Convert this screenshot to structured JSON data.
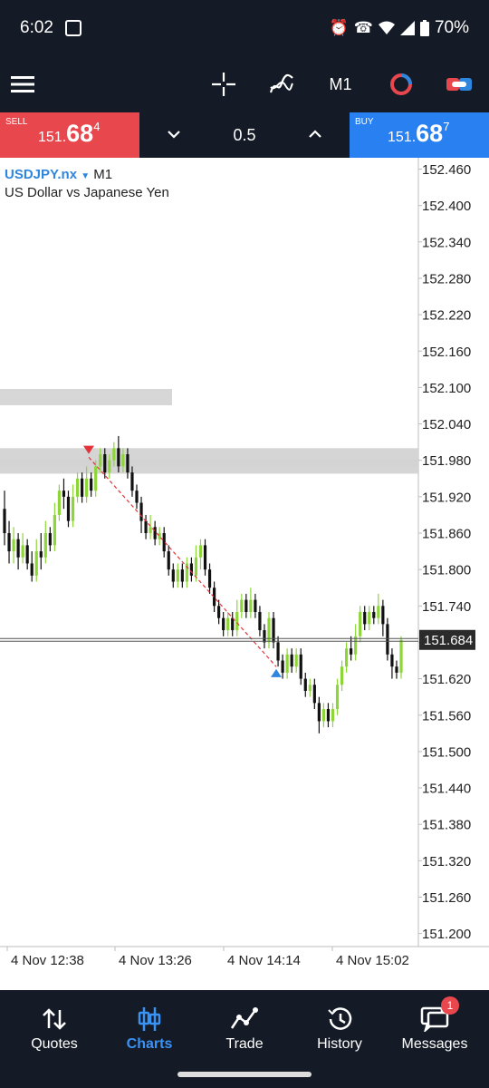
{
  "status_bar": {
    "time": "6:02",
    "battery": "70%"
  },
  "toolbar": {
    "timeframe": "M1"
  },
  "trade": {
    "sell": {
      "label": "SELL",
      "price_prefix": "151.",
      "price_big": "68",
      "price_sup": "4"
    },
    "buy": {
      "label": "BUY",
      "price_prefix": "151.",
      "price_big": "68",
      "price_sup": "7"
    },
    "volume": "0.5"
  },
  "chart_header": {
    "symbol": "USDJPY.nx",
    "timeframe": "M1",
    "description": "US Dollar vs Japanese Yen"
  },
  "chart_data": {
    "type": "candlestick",
    "symbol": "USDJPY.nx",
    "timeframe": "M1",
    "ylim": [
      151.16,
      152.49
    ],
    "y_ticks": [
      "152.460",
      "152.400",
      "152.340",
      "152.280",
      "152.220",
      "152.160",
      "152.100",
      "152.040",
      "151.980",
      "151.920",
      "151.860",
      "151.800",
      "151.740",
      "151.680",
      "151.620",
      "151.560",
      "151.500",
      "151.440",
      "151.380",
      "151.320",
      "151.260",
      "151.200"
    ],
    "x_ticks": [
      "4 Nov 12:38",
      "4 Nov 13:26",
      "4 Nov 14:14",
      "4 Nov 15:02"
    ],
    "current_price": "151.684",
    "colors": {
      "bull": "#8ed53a",
      "bear": "#111111",
      "price_line": "#555555",
      "trend_line": "#e2333a",
      "sell_arrow": "#e2333a",
      "buy_arrow": "#2f86e0",
      "zone": "#d3d3d3"
    },
    "zones": [
      {
        "y_top": 151.982,
        "y_bottom": 151.958,
        "x_from": "start",
        "x_to": "end"
      },
      {
        "y_top": 152.0,
        "y_bottom": 151.97,
        "x_from": "start",
        "x_to": "end"
      }
    ],
    "trend_line": {
      "from": {
        "time": "4 Nov 13:16",
        "price": 151.985
      },
      "to": {
        "time": "4 Nov 14:22",
        "price": 151.64
      }
    },
    "sell_marker": {
      "time": "4 Nov 13:16",
      "price": 151.995
    },
    "buy_marker": {
      "time": "4 Nov 14:22",
      "price": 151.63
    },
    "candles": [
      [
        151.9,
        151.86,
        151.93,
        151.84
      ],
      [
        151.86,
        151.83,
        151.88,
        151.81
      ],
      [
        151.83,
        151.85,
        151.87,
        151.81
      ],
      [
        151.85,
        151.82,
        151.86,
        151.8
      ],
      [
        151.82,
        151.84,
        151.86,
        151.81
      ],
      [
        151.84,
        151.81,
        151.85,
        151.8
      ],
      [
        151.81,
        151.79,
        151.83,
        151.78
      ],
      [
        151.79,
        151.83,
        151.85,
        151.78
      ],
      [
        151.83,
        151.82,
        151.86,
        151.8
      ],
      [
        151.82,
        151.86,
        151.88,
        151.81
      ],
      [
        151.86,
        151.84,
        151.87,
        151.83
      ],
      [
        151.84,
        151.89,
        151.91,
        151.83
      ],
      [
        151.89,
        151.93,
        151.94,
        151.88
      ],
      [
        151.93,
        151.92,
        151.95,
        151.9
      ],
      [
        151.92,
        151.88,
        151.93,
        151.87
      ],
      [
        151.88,
        151.92,
        151.94,
        151.87
      ],
      [
        151.92,
        151.95,
        151.96,
        151.91
      ],
      [
        151.95,
        151.92,
        151.96,
        151.91
      ],
      [
        151.92,
        151.95,
        151.97,
        151.91
      ],
      [
        151.95,
        151.93,
        151.96,
        151.92
      ],
      [
        151.93,
        151.97,
        151.98,
        151.92
      ],
      [
        151.97,
        151.99,
        152.0,
        151.96
      ],
      [
        151.99,
        151.96,
        152.0,
        151.95
      ],
      [
        151.96,
        151.98,
        151.99,
        151.95
      ],
      [
        151.98,
        152.0,
        152.01,
        151.97
      ],
      [
        152.0,
        151.97,
        152.02,
        151.96
      ],
      [
        151.97,
        151.99,
        152.0,
        151.96
      ],
      [
        151.99,
        151.96,
        152.0,
        151.95
      ],
      [
        151.96,
        151.93,
        151.97,
        151.92
      ],
      [
        151.93,
        151.91,
        151.94,
        151.9
      ],
      [
        151.91,
        151.88,
        151.92,
        151.86
      ],
      [
        151.88,
        151.86,
        151.89,
        151.85
      ],
      [
        151.86,
        151.87,
        151.89,
        151.85
      ],
      [
        151.87,
        151.85,
        151.88,
        151.84
      ],
      [
        151.85,
        151.86,
        151.87,
        151.84
      ],
      [
        151.86,
        151.83,
        151.87,
        151.82
      ],
      [
        151.83,
        151.8,
        151.84,
        151.79
      ],
      [
        151.8,
        151.78,
        151.81,
        151.77
      ],
      [
        151.78,
        151.8,
        151.81,
        151.77
      ],
      [
        151.8,
        151.78,
        151.81,
        151.77
      ],
      [
        151.78,
        151.81,
        151.82,
        151.77
      ],
      [
        151.81,
        151.79,
        151.82,
        151.78
      ],
      [
        151.79,
        151.82,
        151.84,
        151.78
      ],
      [
        151.82,
        151.84,
        151.85,
        151.8
      ],
      [
        151.84,
        151.8,
        151.85,
        151.79
      ],
      [
        151.8,
        151.77,
        151.81,
        151.76
      ],
      [
        151.77,
        151.74,
        151.78,
        151.73
      ],
      [
        151.74,
        151.72,
        151.75,
        151.71
      ],
      [
        151.72,
        151.7,
        151.73,
        151.69
      ],
      [
        151.7,
        151.72,
        151.73,
        151.69
      ],
      [
        151.72,
        151.7,
        151.73,
        151.69
      ],
      [
        151.7,
        151.73,
        151.75,
        151.69
      ],
      [
        151.73,
        151.75,
        151.76,
        151.72
      ],
      [
        151.75,
        151.73,
        151.76,
        151.72
      ],
      [
        151.73,
        151.75,
        151.77,
        151.72
      ],
      [
        151.75,
        151.73,
        151.76,
        151.72
      ],
      [
        151.73,
        151.7,
        151.74,
        151.69
      ],
      [
        151.7,
        151.68,
        151.71,
        151.67
      ],
      [
        151.68,
        151.72,
        151.73,
        151.67
      ],
      [
        151.72,
        151.68,
        151.73,
        151.67
      ],
      [
        151.68,
        151.65,
        151.69,
        151.64
      ],
      [
        151.65,
        151.63,
        151.66,
        151.62
      ],
      [
        151.63,
        151.66,
        151.67,
        151.62
      ],
      [
        151.66,
        151.64,
        151.67,
        151.63
      ],
      [
        151.64,
        151.66,
        151.67,
        151.63
      ],
      [
        151.66,
        151.62,
        151.67,
        151.61
      ],
      [
        151.62,
        151.6,
        151.63,
        151.59
      ],
      [
        151.6,
        151.61,
        151.62,
        151.59
      ],
      [
        151.61,
        151.58,
        151.62,
        151.57
      ],
      [
        151.58,
        151.55,
        151.59,
        151.53
      ],
      [
        151.55,
        151.57,
        151.58,
        151.54
      ],
      [
        151.57,
        151.55,
        151.58,
        151.54
      ],
      [
        151.55,
        151.57,
        151.58,
        151.54
      ],
      [
        151.57,
        151.61,
        151.62,
        151.56
      ],
      [
        151.61,
        151.64,
        151.65,
        151.6
      ],
      [
        151.64,
        151.67,
        151.68,
        151.63
      ],
      [
        151.67,
        151.66,
        151.69,
        151.65
      ],
      [
        151.66,
        151.69,
        151.71,
        151.65
      ],
      [
        151.69,
        151.73,
        151.74,
        151.68
      ],
      [
        151.73,
        151.71,
        151.74,
        151.7
      ],
      [
        151.71,
        151.73,
        151.74,
        151.7
      ],
      [
        151.73,
        151.72,
        151.74,
        151.71
      ],
      [
        151.72,
        151.74,
        151.76,
        151.71
      ],
      [
        151.74,
        151.71,
        151.75,
        151.69
      ],
      [
        151.71,
        151.66,
        151.72,
        151.65
      ],
      [
        151.66,
        151.64,
        151.67,
        151.62
      ],
      [
        151.64,
        151.63,
        151.65,
        151.62
      ],
      [
        151.63,
        151.684,
        151.69,
        151.62
      ]
    ]
  },
  "bottom_nav": [
    {
      "label": "Quotes"
    },
    {
      "label": "Charts"
    },
    {
      "label": "Trade"
    },
    {
      "label": "History"
    },
    {
      "label": "Messages",
      "badge": "1"
    }
  ]
}
